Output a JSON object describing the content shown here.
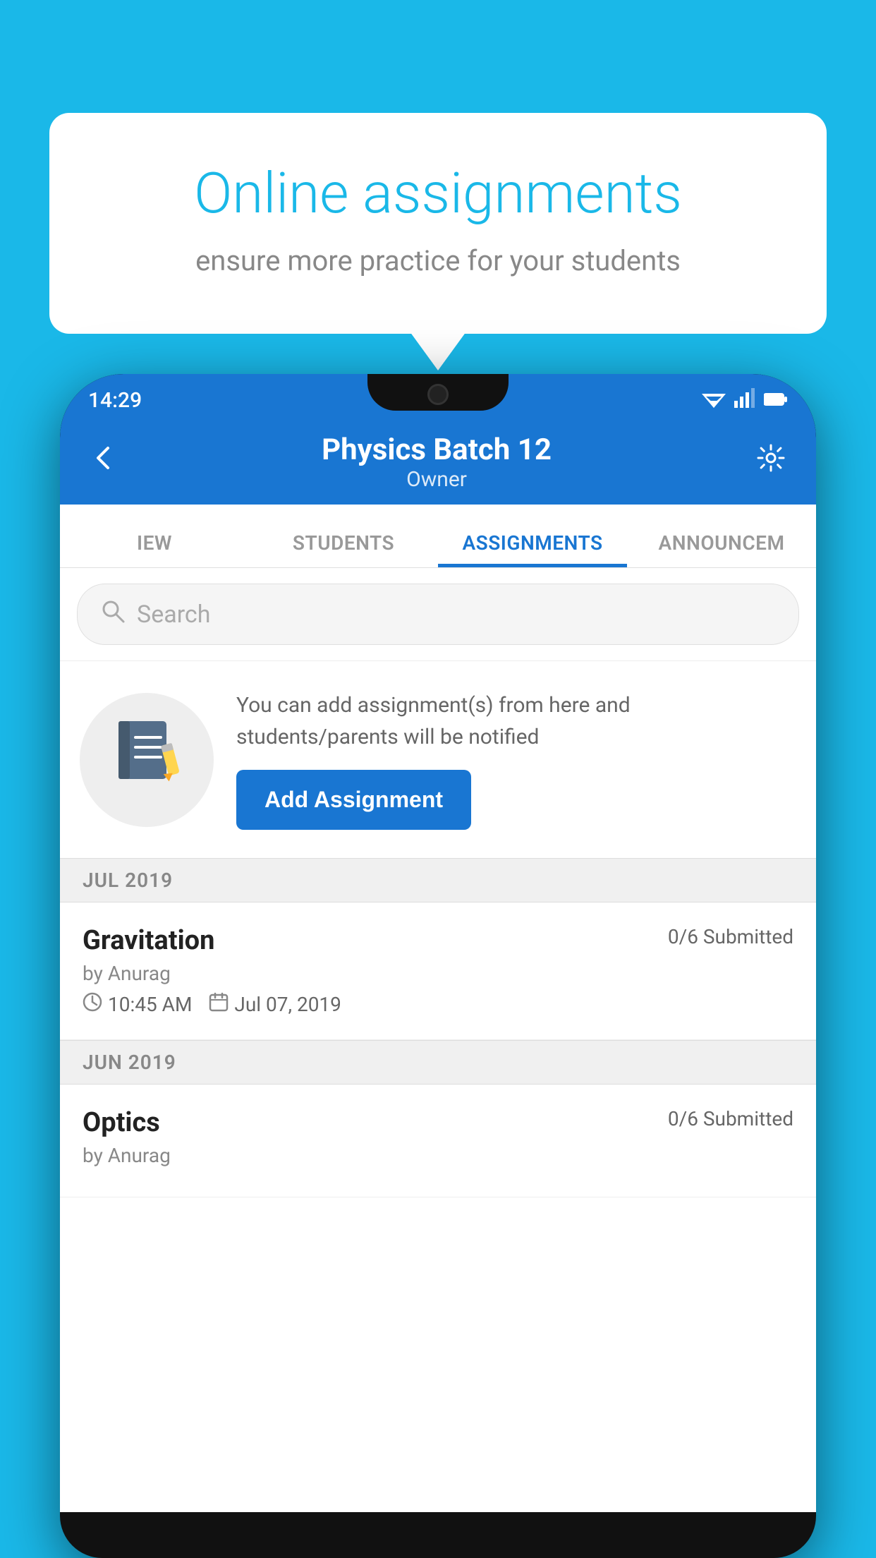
{
  "background_color": "#1ab8e8",
  "speech_bubble": {
    "title": "Online assignments",
    "subtitle": "ensure more practice for your students"
  },
  "status_bar": {
    "time": "14:29",
    "wifi_icon": "▼",
    "signal_icon": "◀",
    "battery_icon": "▮"
  },
  "app_bar": {
    "back_icon": "←",
    "title": "Physics Batch 12",
    "subtitle": "Owner",
    "settings_icon": "⚙"
  },
  "tabs": [
    {
      "label": "IEW",
      "active": false
    },
    {
      "label": "STUDENTS",
      "active": false
    },
    {
      "label": "ASSIGNMENTS",
      "active": true
    },
    {
      "label": "ANNOUNCEM",
      "active": false
    }
  ],
  "search": {
    "placeholder": "Search"
  },
  "prompt": {
    "description": "You can add assignment(s) from here and students/parents will be notified",
    "add_button_label": "Add Assignment"
  },
  "months": [
    {
      "label": "JUL 2019",
      "assignments": [
        {
          "name": "Gravitation",
          "submitted": "0/6 Submitted",
          "by": "by Anurag",
          "time": "10:45 AM",
          "date": "Jul 07, 2019"
        }
      ]
    },
    {
      "label": "JUN 2019",
      "assignments": [
        {
          "name": "Optics",
          "submitted": "0/6 Submitted",
          "by": "by Anurag",
          "time": "",
          "date": ""
        }
      ]
    }
  ]
}
